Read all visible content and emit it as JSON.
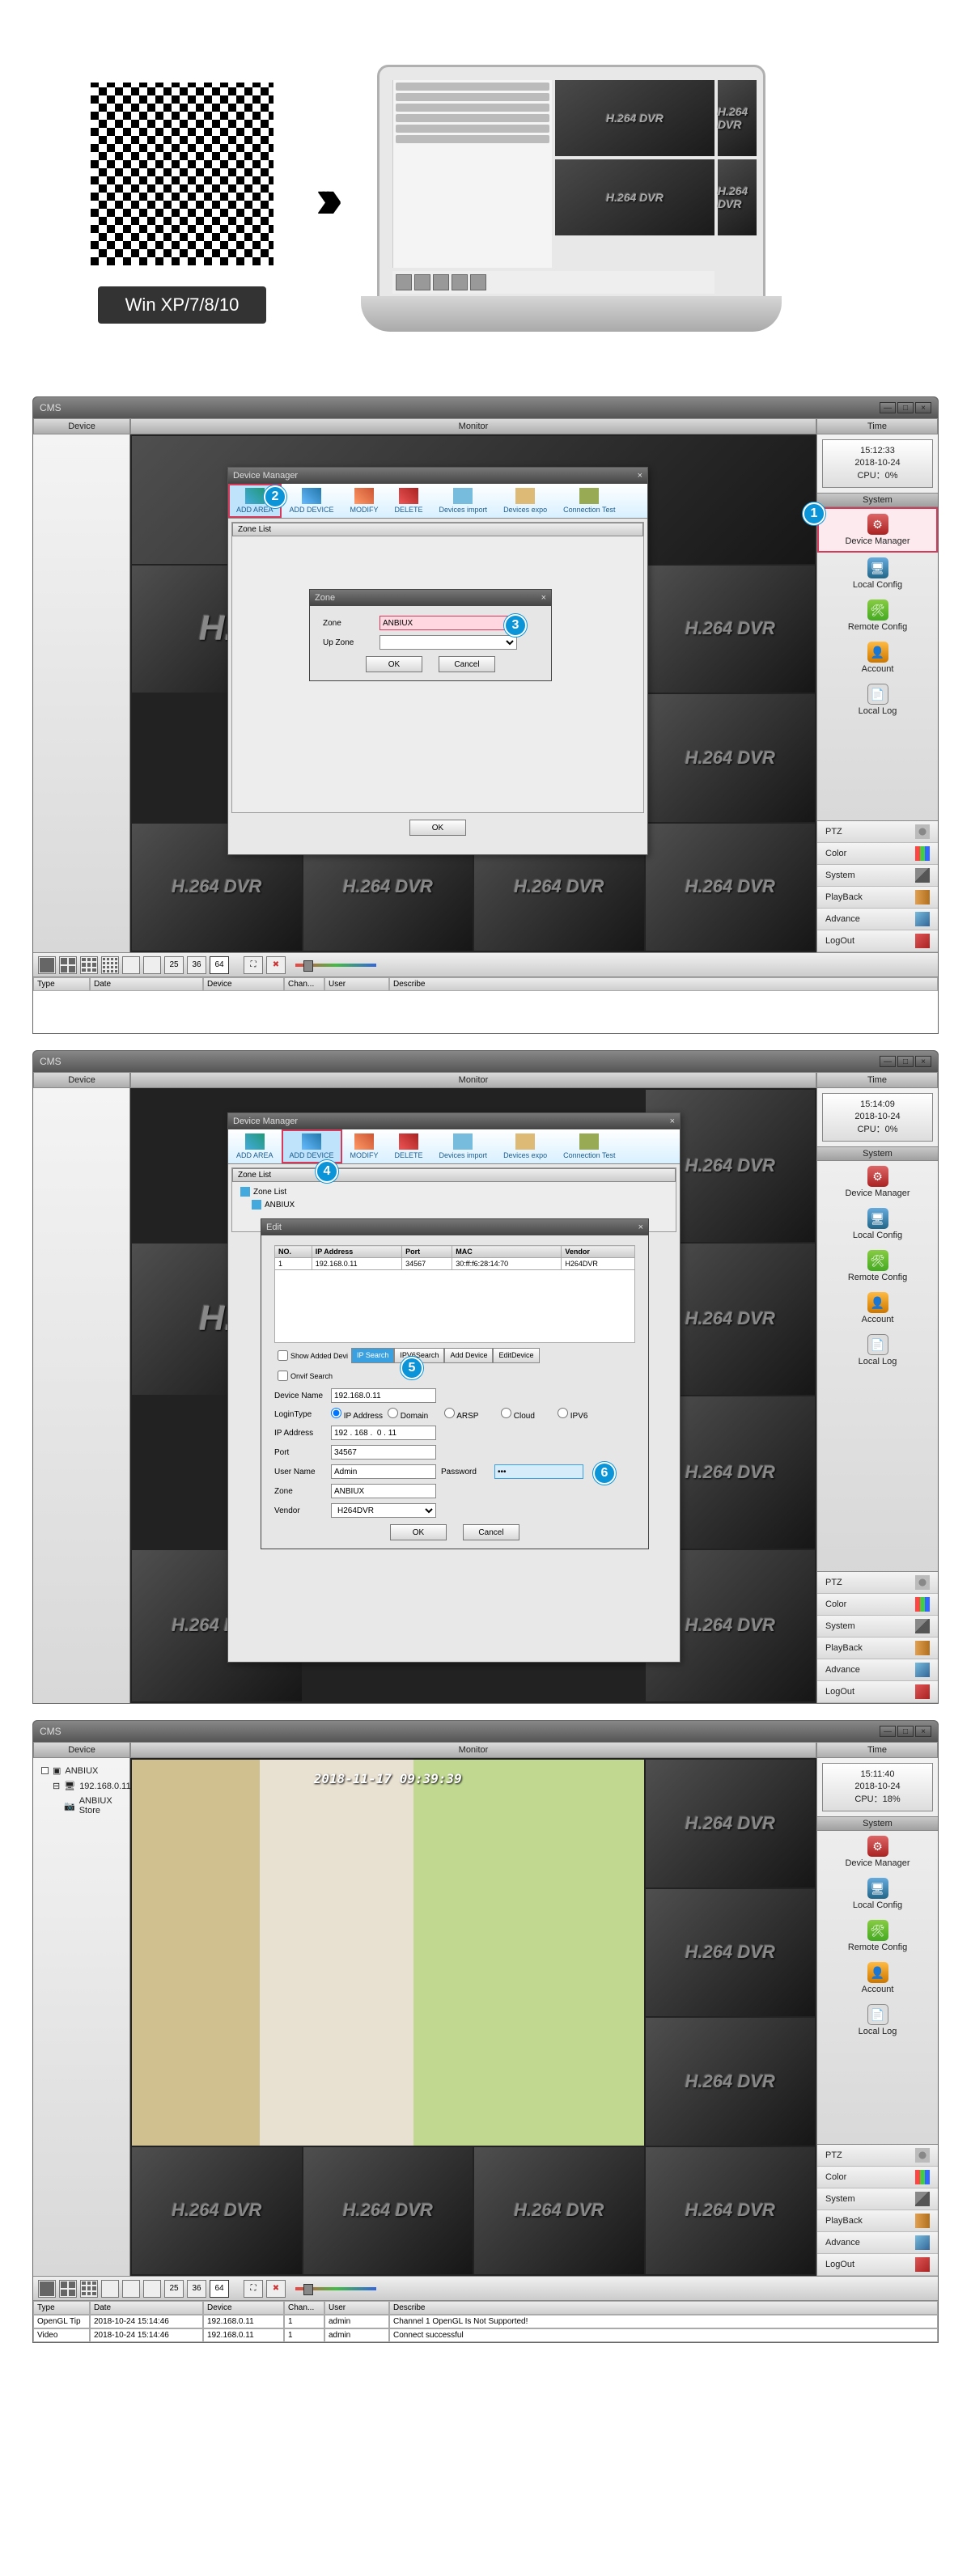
{
  "top": {
    "qr_label": "Win XP/7/8/10",
    "dvr_text": "H.264 DVR"
  },
  "app": {
    "title": "CMS",
    "header": {
      "device": "Device",
      "monitor": "Monitor",
      "time": "Time"
    },
    "win_btns": {
      "min": "—",
      "max": "□",
      "close": "×"
    }
  },
  "clock": [
    {
      "time": "15:12:33",
      "date": "2018-10-24",
      "cpu": "CPU：0%"
    },
    {
      "time": "15:14:09",
      "date": "2018-10-24",
      "cpu": "CPU：0%"
    },
    {
      "time": "15:11:40",
      "date": "2018-10-24",
      "cpu": "CPU：18%"
    }
  ],
  "system": {
    "header": "System",
    "items": [
      {
        "key": "device-manager",
        "label": "Device Manager"
      },
      {
        "key": "local-config",
        "label": "Local Config"
      },
      {
        "key": "remote-config",
        "label": "Remote Config"
      },
      {
        "key": "account",
        "label": "Account"
      },
      {
        "key": "local-log",
        "label": "Local Log"
      }
    ]
  },
  "options": [
    {
      "key": "ptz",
      "label": "PTZ"
    },
    {
      "key": "color",
      "label": "Color"
    },
    {
      "key": "system",
      "label": "System"
    },
    {
      "key": "playback",
      "label": "PlayBack"
    },
    {
      "key": "advance",
      "label": "Advance"
    },
    {
      "key": "logout",
      "label": "LogOut"
    }
  ],
  "toolbar_nums": [
    "25",
    "36",
    "64"
  ],
  "log_table": {
    "headers": {
      "type": "Type",
      "date": "Date",
      "device": "Device",
      "chan": "Chan...",
      "user": "User",
      "desc": "Describe"
    },
    "rows3": [
      {
        "type": "OpenGL Tip",
        "date": "2018-10-24 15:14:46",
        "device": "192.168.0.11",
        "chan": "1",
        "user": "admin",
        "desc": "Channel 1 OpenGL Is Not Supported!"
      },
      {
        "type": "Video",
        "date": "2018-10-24 15:14:46",
        "device": "192.168.0.11",
        "chan": "1",
        "user": "admin",
        "desc": "Connect successful"
      }
    ]
  },
  "device_tree": {
    "root": "ANBIUX",
    "ip": "192.168.0.11",
    "leaf": "ANBIUX Store"
  },
  "dvr_text": "H.264 DVR",
  "live_overlay": "2018-11-17 09:39:39",
  "dlg": {
    "title": "Device Manager",
    "close": "×",
    "toolbar": [
      {
        "key": "add-area",
        "label": "ADD AREA"
      },
      {
        "key": "add-device",
        "label": "ADD DEVICE"
      },
      {
        "key": "modify",
        "label": "MODIFY"
      },
      {
        "key": "delete",
        "label": "DELETE"
      },
      {
        "key": "import",
        "label": "Devices import"
      },
      {
        "key": "export",
        "label": "Devices expo"
      },
      {
        "key": "conn-test",
        "label": "Connection Test"
      }
    ],
    "zone_list_hdr": "Zone List",
    "zone_tree": [
      "Zone List",
      "ANBIUX"
    ],
    "ok": "OK",
    "cancel": "Cancel"
  },
  "zone_dlg": {
    "title": "Zone",
    "zone_lbl": "Zone",
    "zone_val": "ANBIUX",
    "up_lbl": "Up Zone",
    "up_val": "",
    "ok": "OK",
    "cancel": "Cancel"
  },
  "edit_dlg": {
    "title": "Edit",
    "table": {
      "headers": {
        "no": "NO.",
        "ip": "IP Address",
        "port": "Port",
        "mac": "MAC",
        "vendor": "Vendor"
      },
      "row": {
        "no": "1",
        "ip": "192.168.0.11",
        "port": "34567",
        "mac": "30:ff:f6:28:14:70",
        "vendor": "H264DVR"
      }
    },
    "chk_show": "Show Added Devi",
    "tabs": [
      "IP Search",
      "IPV6Search",
      "Add Device",
      "EditDevice"
    ],
    "onvif": "Onvif Search",
    "fields": {
      "device_name": {
        "lbl": "Device Name",
        "val": "192.168.0.11"
      },
      "login_type": {
        "lbl": "LoginType",
        "opts": [
          "IP Address",
          "Domain",
          "ARSP",
          "Cloud",
          "IPV6"
        ]
      },
      "ip": {
        "lbl": "IP Address",
        "val": "192 . 168 .  0 . 11"
      },
      "port": {
        "lbl": "Port",
        "val": "34567"
      },
      "user": {
        "lbl": "User Name",
        "val": "Admin"
      },
      "pwd": {
        "lbl": "Password",
        "val": "•••"
      },
      "zone": {
        "lbl": "Zone",
        "val": "ANBIUX"
      },
      "vendor": {
        "lbl": "Vendor",
        "val": "H264DVR"
      }
    },
    "ok": "OK",
    "cancel": "Cancel"
  },
  "bubbles": {
    "b1": "1",
    "b2": "2",
    "b3": "3",
    "b4": "4",
    "b5": "5",
    "b6": "6"
  }
}
